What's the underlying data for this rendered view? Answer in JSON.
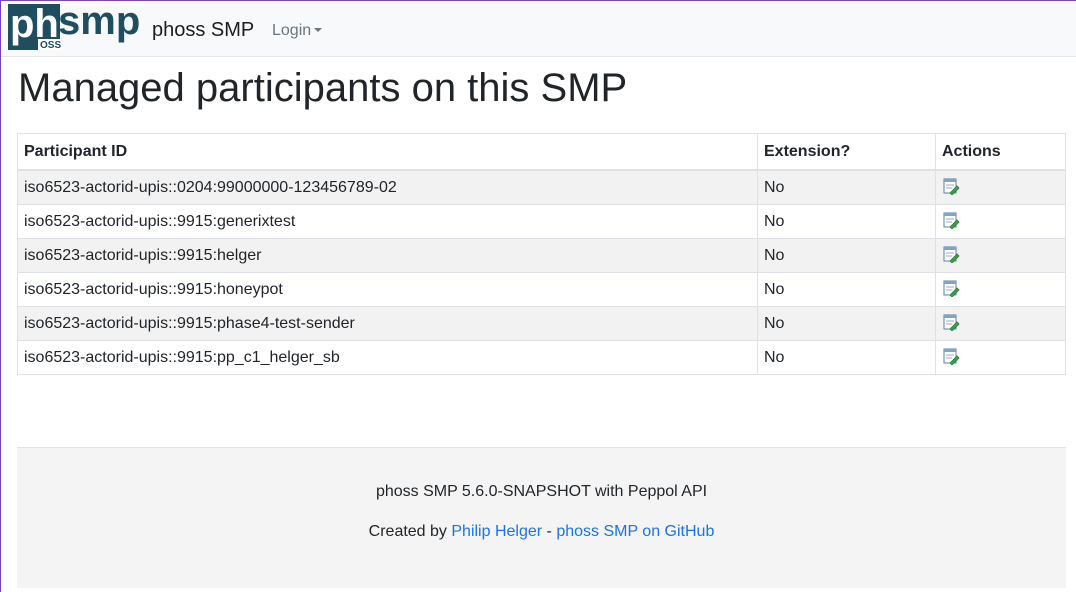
{
  "brand": {
    "logo_alt": "phsmp",
    "name": "phoss SMP"
  },
  "nav": {
    "login_label": "Login"
  },
  "page": {
    "title": "Managed participants on this SMP"
  },
  "table": {
    "headers": {
      "participant_id": "Participant ID",
      "extension": "Extension?",
      "actions": "Actions"
    },
    "rows": [
      {
        "participant_id": "iso6523-actorid-upis::0204:99000000-123456789-02",
        "extension": "No",
        "action_icon": "edit-icon"
      },
      {
        "participant_id": "iso6523-actorid-upis::9915:generixtest",
        "extension": "No",
        "action_icon": "edit-icon"
      },
      {
        "participant_id": "iso6523-actorid-upis::9915:helger",
        "extension": "No",
        "action_icon": "edit-icon"
      },
      {
        "participant_id": "iso6523-actorid-upis::9915:honeypot",
        "extension": "No",
        "action_icon": "edit-icon"
      },
      {
        "participant_id": "iso6523-actorid-upis::9915:phase4-test-sender",
        "extension": "No",
        "action_icon": "edit-icon"
      },
      {
        "participant_id": "iso6523-actorid-upis::9915:pp_c1_helger_sb",
        "extension": "No",
        "action_icon": "edit-icon"
      }
    ]
  },
  "footer": {
    "version_text": "phoss SMP 5.6.0-SNAPSHOT with Peppol API",
    "created_by_prefix": "Created by",
    "author_link": "Philip Helger",
    "separator": "-",
    "github_link": "phoss SMP on GitHub"
  },
  "colors": {
    "logo": "#1f4e61",
    "link": "#1a73e8",
    "navbar_bg": "#f8f9fa",
    "stripe": "#f2f2f2",
    "footer_bg": "#f4f4f4"
  }
}
